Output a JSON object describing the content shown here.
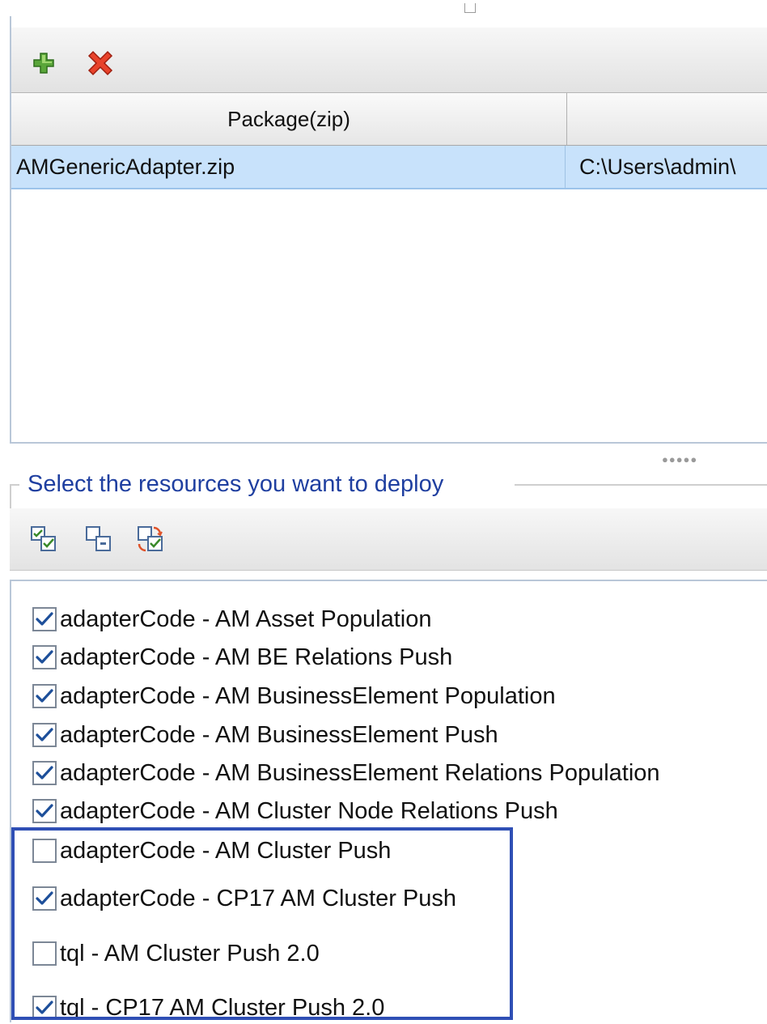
{
  "package_table": {
    "columns": [
      "Package(zip)",
      ""
    ],
    "rows": [
      {
        "package": "AMGenericAdapter.zip",
        "path": "C:\\Users\\admin\\"
      }
    ]
  },
  "toolbar": {
    "add_icon": "add-icon",
    "remove_icon": "remove-icon"
  },
  "resources": {
    "group_title": "Select the resources you want to deploy",
    "toolbar_icons": [
      "select-all-icon",
      "deselect-all-icon",
      "invert-selection-icon"
    ],
    "items": [
      {
        "label": "adapterCode - AM Asset Population",
        "checked": true
      },
      {
        "label": "adapterCode - AM BE Relations Push",
        "checked": true
      },
      {
        "label": "adapterCode - AM BusinessElement Population",
        "checked": true
      },
      {
        "label": "adapterCode - AM BusinessElement Push",
        "checked": true
      },
      {
        "label": "adapterCode - AM BusinessElement Relations Population",
        "checked": true
      },
      {
        "label": "adapterCode - AM Cluster Node Relations Push",
        "checked": true
      },
      {
        "label": "adapterCode - AM Cluster Push",
        "checked": false
      },
      {
        "label": "adapterCode - CP17 AM Cluster Push",
        "checked": true
      },
      {
        "label": "tql - AM Cluster Push 2.0",
        "checked": false
      },
      {
        "label": "tql - CP17 AM Cluster Push 2.0",
        "checked": true
      }
    ]
  },
  "colors": {
    "selection_row": "#c8e2fb",
    "group_title": "#1f3fa0",
    "highlight_border": "#2f4fb5",
    "checkmark": "#1d4f9a"
  }
}
